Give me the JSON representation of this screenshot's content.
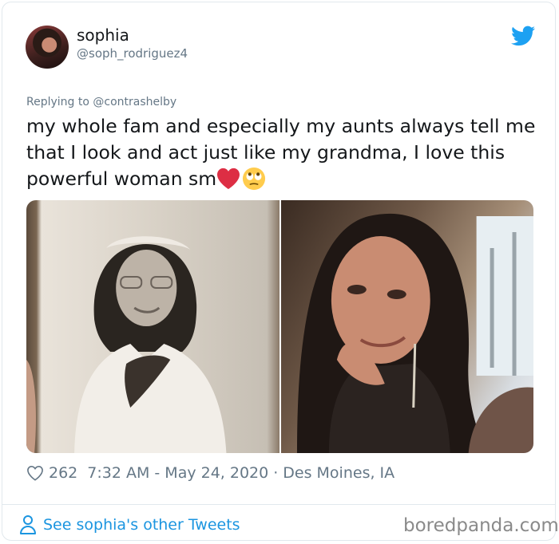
{
  "tweet": {
    "user": {
      "display_name": "sophia",
      "handle": "@soph_rodriguez4"
    },
    "replying_to": "Replying to @contrashelby",
    "text": "my whole fam and especially my aunts always tell me that I look and act just like my grandma, I love this powerful woman sm",
    "emojis": [
      "red-heart",
      "face-with-rolling-eyes"
    ],
    "photos": [
      {
        "description_icon": "vintage-portrait-photo"
      },
      {
        "description_icon": "selfie-photo"
      }
    ],
    "likes": "262",
    "timestamp": "7:32 AM - May 24, 2020",
    "separator": "·",
    "location": "Des Moines, IA"
  },
  "footer": {
    "see_more": "See sophia's other Tweets",
    "watermark": "boredpanda.com"
  },
  "colors": {
    "twitter_blue": "#1da1f2",
    "link_blue": "#1b95e0",
    "text_dark": "#14171a",
    "text_gray": "#657786",
    "border": "#e1e8ed"
  }
}
